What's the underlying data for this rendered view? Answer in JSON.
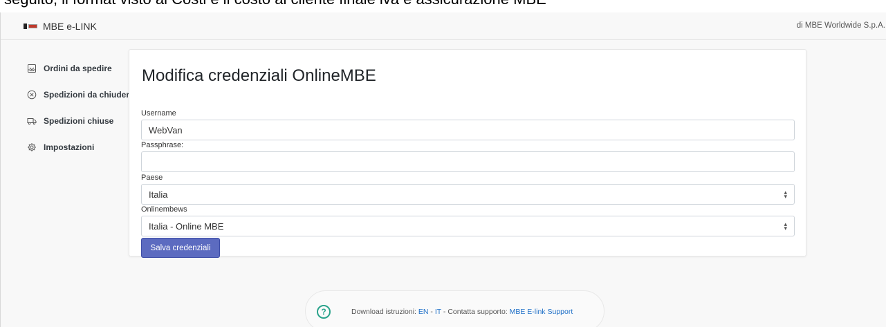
{
  "doc_strip": {
    "text": "seguito, il format visto ai Costi è il costo al cliente finale iva e assicurazione MBE"
  },
  "header": {
    "app_name": "MBE e-LINK",
    "company": "di MBE Worldwide S.p.A."
  },
  "sidebar": {
    "items": [
      {
        "label": "Ordini da spedire",
        "icon": "inbox-tray-icon"
      },
      {
        "label": "Spedizioni da chiudere",
        "icon": "close-circle-icon"
      },
      {
        "label": "Spedizioni chiuse",
        "icon": "truck-icon"
      },
      {
        "label": "Impostazioni",
        "icon": "gear-icon"
      }
    ]
  },
  "form": {
    "title": "Modifica credenziali OnlineMBE",
    "username_label": "Username",
    "username_value": "WebVan",
    "passphrase_label": "Passphrase:",
    "passphrase_value": "",
    "country_label": "Paese",
    "country_value": "Italia",
    "onlinembews_label": "Onlinembews",
    "onlinembews_value": "Italia - Online MBE",
    "save_label": "Salva credenziali"
  },
  "footer": {
    "prefix": "Download istruzioni: ",
    "en": "EN",
    "sep1": " - ",
    "it": "IT",
    "middle": " - Contatta supporto: ",
    "support": "MBE E-link Support"
  },
  "colors": {
    "accent": "#5c6bc0",
    "link": "#1e6fc7",
    "help": "#2aa38b"
  }
}
